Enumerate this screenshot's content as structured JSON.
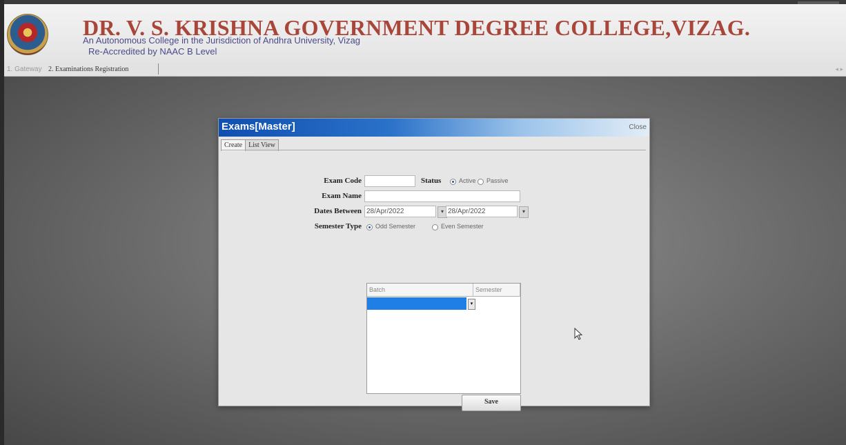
{
  "header": {
    "college_name": "DR. V. S. KRISHNA GOVERNMENT DEGREE COLLEGE,VIZAG.",
    "subtitle": "An Autonomous College in the Jurisdiction of Andhra University, Vizag",
    "accreditation": "Re-Accredited by NAAC B Level"
  },
  "nav": {
    "tabs": [
      "1. Gateway",
      "2. Examinations Registration"
    ]
  },
  "dialog": {
    "title": "Exams[Master]",
    "close_label": "Close",
    "tabs": [
      "Create",
      "List View"
    ],
    "form": {
      "exam_code_label": "Exam Code",
      "exam_code_value": "",
      "status_label": "Status",
      "status_options": [
        "Active",
        "Passive"
      ],
      "status_selected": "Active",
      "exam_name_label": "Exam Name",
      "exam_name_value": "",
      "dates_label": "Dates Between",
      "date_from": "28/Apr/2022",
      "date_to": "28/Apr/2022",
      "semester_type_label": "Semester Type",
      "semester_options": [
        "Odd Semester",
        "Even Semester"
      ],
      "semester_selected": "Odd Semester"
    },
    "grid": {
      "columns": [
        "Batch",
        "Semester"
      ]
    },
    "save_label": "Save"
  },
  "colors": {
    "title_bar": "#0f4fb0",
    "college_name": "#a8463a",
    "selected_row": "#1f7fe6"
  }
}
